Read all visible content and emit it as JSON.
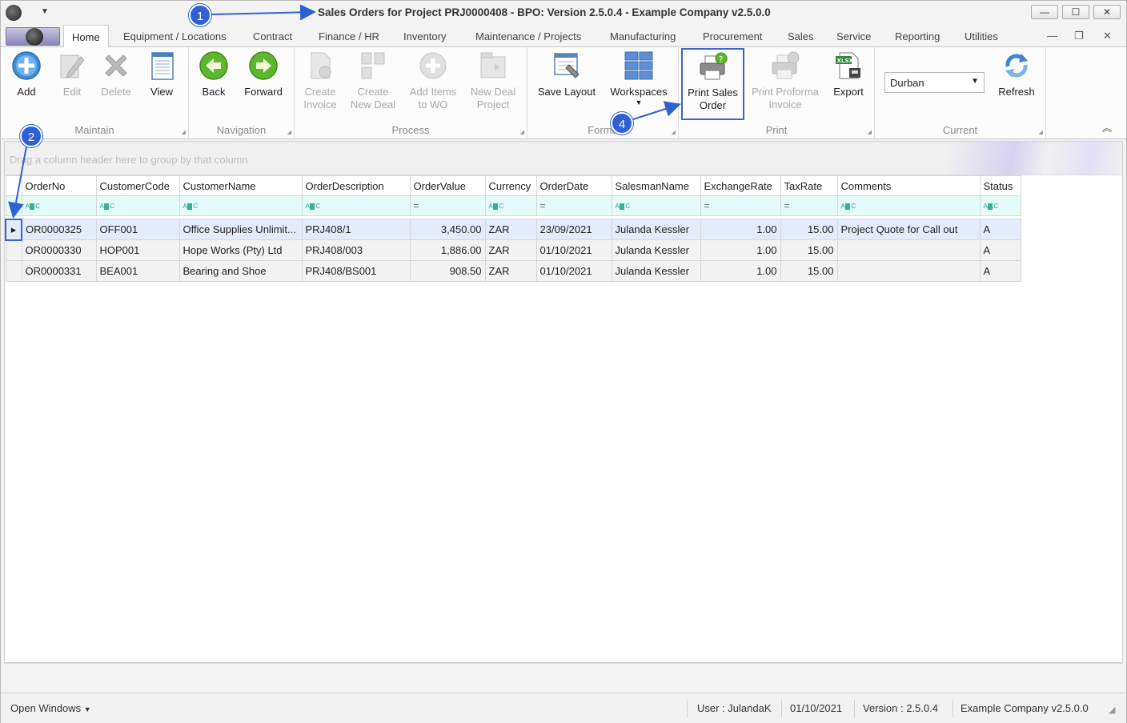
{
  "window": {
    "title": "Sales Orders for Project PRJ0000408 - BPO: Version 2.5.0.4 - Example Company v2.5.0.0",
    "controls": [
      "—",
      "☐",
      "✕"
    ]
  },
  "tabs": [
    "Home",
    "Equipment / Locations",
    "Contract",
    "Finance / HR",
    "Inventory",
    "Maintenance / Projects",
    "Manufacturing",
    "Procurement",
    "Sales",
    "Service",
    "Reporting",
    "Utilities"
  ],
  "ribbon": {
    "maintain": {
      "label": "Maintain",
      "add": "Add",
      "edit": "Edit",
      "delete": "Delete",
      "view": "View"
    },
    "navigation": {
      "label": "Navigation",
      "back": "Back",
      "forward": "Forward"
    },
    "process": {
      "label": "Process",
      "create_invoice_1": "Create",
      "create_invoice_2": "Invoice",
      "create_deal_1": "Create",
      "create_deal_2": "New Deal",
      "add_items_1": "Add Items",
      "add_items_2": "to WO",
      "new_deal_1": "New Deal",
      "new_deal_2": "Project"
    },
    "format": {
      "label": "Forma",
      "save_layout": "Save Layout",
      "workspaces": "Workspaces"
    },
    "print": {
      "label": "Print",
      "print_sales_1": "Print Sales",
      "print_sales_2": "Order",
      "print_proforma_1": "Print Proforma",
      "print_proforma_2": "Invoice",
      "export": "Export"
    },
    "current": {
      "label": "Current",
      "site": "Durban",
      "refresh": "Refresh"
    }
  },
  "grid": {
    "group_hint": "Drag a column header here to group by that column",
    "columns": [
      "OrderNo",
      "CustomerCode",
      "CustomerName",
      "OrderDescription",
      "OrderValue",
      "Currency",
      "OrderDate",
      "SalesmanName",
      "ExchangeRate",
      "TaxRate",
      "Comments",
      "Status"
    ],
    "rows": [
      [
        "OR0000325",
        "OFF001",
        "Office Supplies Unlimit...",
        "PRJ408/1",
        "3,450.00",
        "ZAR",
        "23/09/2021",
        "Julanda Kessler",
        "1.00",
        "15.00",
        "Project Quote for Call out",
        "A"
      ],
      [
        "OR0000330",
        "HOP001",
        "Hope Works (Pty) Ltd",
        "PRJ408/003",
        "1,886.00",
        "ZAR",
        "01/10/2021",
        "Julanda Kessler",
        "1.00",
        "15.00",
        "",
        "A"
      ],
      [
        "OR0000331",
        "BEA001",
        "Bearing and Shoe",
        "PRJ408/BS001",
        "908.50",
        "ZAR",
        "01/10/2021",
        "Julanda Kessler",
        "1.00",
        "15.00",
        "",
        "A"
      ]
    ]
  },
  "status": {
    "open_windows": "Open Windows",
    "user": "User : JulandaK",
    "date": "01/10/2021",
    "version": "Version : 2.5.0.4",
    "company": "Example Company v2.5.0.0"
  },
  "annotations": [
    "1",
    "2",
    "4"
  ],
  "colors": {
    "accent": "#2f61d4",
    "filter_row": "#e5fbf9",
    "selected_row": "#e4ecfb"
  }
}
